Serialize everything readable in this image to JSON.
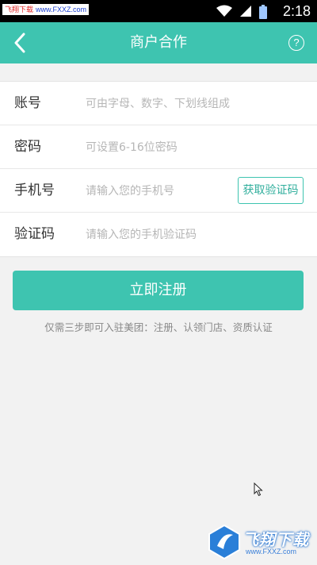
{
  "status_bar": {
    "badge_text": "飞翔下载",
    "badge_url": "www.FXXZ.com",
    "time": "2:18"
  },
  "nav": {
    "title": "商户合作",
    "back_icon": "chevron-left-icon",
    "help_label": "?"
  },
  "form": {
    "account": {
      "label": "账号",
      "placeholder": "可由字母、数字、下划线组成",
      "value": ""
    },
    "password": {
      "label": "密码",
      "placeholder": "可设置6-16位密码",
      "value": ""
    },
    "phone": {
      "label": "手机号",
      "placeholder": "请输入您的手机号",
      "value": ""
    },
    "code": {
      "label": "验证码",
      "placeholder": "请输入您的手机验证码",
      "value": ""
    },
    "get_code_label": "获取验证码"
  },
  "submit_label": "立即注册",
  "hint": "仅需三步即可入驻美团：注册、认领门店、资质认证",
  "watermark": {
    "text": "飞翔下载",
    "url": "www.FXXZ.com"
  },
  "colors": {
    "accent": "#3ec4b0",
    "background": "#f2f2f2"
  }
}
